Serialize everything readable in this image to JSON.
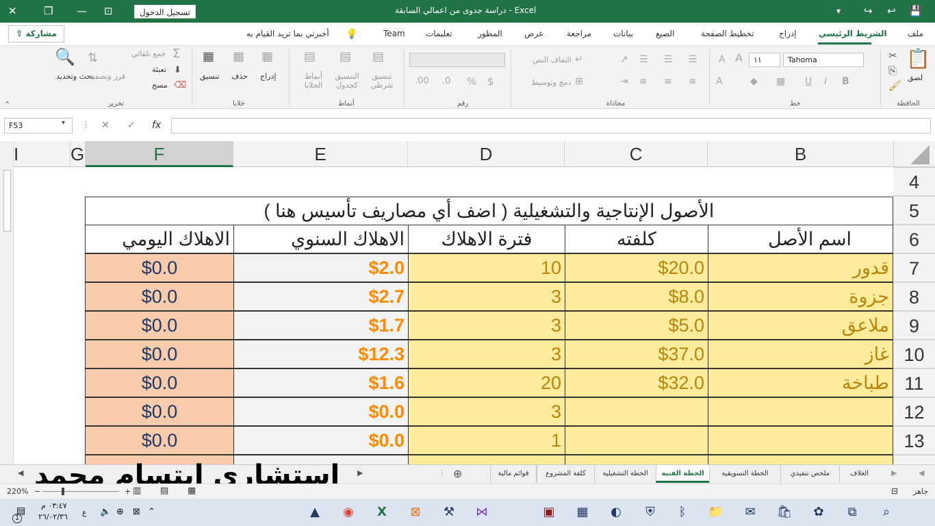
{
  "window": {
    "title": "دراسة جدوى من اعمالي السابقة  -  Excel",
    "signin": "تسجيل الدخول"
  },
  "ribbon_tabs": [
    "ملف",
    "الشريط الرئيسي",
    "إدراج",
    "تخطيط الصفحة",
    "الصيغ",
    "بيانات",
    "مراجعة",
    "عرض",
    "المطور",
    "تعليمات",
    "Team"
  ],
  "tell_me": "أخبرني بما تريد القيام به",
  "share": "مشاركة",
  "ribbon": {
    "clipboard": {
      "paste": "لصق",
      "group": "الحافظة"
    },
    "font": {
      "name": "Tahoma",
      "size": "١١",
      "group": "خط"
    },
    "alignment": {
      "wrap": "التفاف النص",
      "merge": "دمج وتوسيط",
      "group": "محاذاة"
    },
    "number": {
      "group": "رقم"
    },
    "styles": {
      "conditional": "تنسيق شرطي",
      "table": "التنسيق كجدول",
      "cell": "أنماط الخلايا",
      "group": "أنماط"
    },
    "cells": {
      "insert": "إدراج",
      "delete": "حذف",
      "format": "تنسيق",
      "group": "خلايا"
    },
    "editing": {
      "autosum": "جمع تلقائي",
      "fill": "تعبئة",
      "clear": "مسح",
      "sort": "فرز وتصفية",
      "find": "بحث وتحديد",
      "group": "تحرير"
    }
  },
  "formula_bar": {
    "name_box": "F53",
    "formula": ""
  },
  "columns": [
    "B",
    "C",
    "D",
    "E",
    "F",
    "G",
    "I"
  ],
  "rows": [
    "4",
    "5",
    "6",
    "7",
    "8",
    "9",
    "10",
    "11",
    "12",
    "13"
  ],
  "table": {
    "title": "الأصول الإنتاجية والتشغيلية ( اضف أي مصاريف تأسيس هنا )",
    "headers": [
      "اسم الأصل",
      "كلفته",
      "فترة الاهلاك",
      "الاهلاك السنوي",
      "الاهلاك اليومي"
    ],
    "data": [
      [
        "قدور",
        "$20.0",
        "10",
        "$2.0",
        "$0.0"
      ],
      [
        "جزوة",
        "$8.0",
        "3",
        "$2.7",
        "$0.0"
      ],
      [
        "ملاعق",
        "$5.0",
        "3",
        "$1.7",
        "$0.0"
      ],
      [
        "غاز",
        "$37.0",
        "3",
        "$12.3",
        "$0.0"
      ],
      [
        "طباخة",
        "$32.0",
        "20",
        "$1.6",
        "$0.0"
      ],
      [
        "",
        "",
        "3",
        "$0.0",
        "$0.0"
      ],
      [
        "",
        "",
        "1",
        "$0.0",
        "$0.0"
      ]
    ]
  },
  "sheets": [
    "الغلاف",
    "ملخص تنفيذي",
    "الخطة التسويقية",
    "الخطة الفنية",
    "الخطة التشغيلية",
    "كلفة المشروع",
    "قوائم مالية"
  ],
  "active_sheet": "الخطة الفنية",
  "watermark": "استشاري  ابتسام  محمد",
  "status": {
    "ready": "جاهز",
    "zoom": "220%"
  },
  "clock": {
    "time": "٠٣:٤٧ م",
    "date": "٢٦/٠٢/٣٦"
  },
  "taskbar_icons": [
    "search-icon",
    "taskview-icon",
    "copilot-icon",
    "store-icon",
    "mail-icon",
    "explorer-icon",
    "bluetooth-icon",
    "defender-icon",
    "edge-icon",
    "calculator-icon",
    "winrar-icon",
    "visual-studio-icon",
    "tools-icon",
    "xampp-icon",
    "excel-icon",
    "chrome-icon",
    "photos-icon"
  ],
  "colors": {
    "excel_green": "#217346",
    "orange": "#ff8c00",
    "yellow_fill": "#ffeb9c",
    "orange_fill": "#f8cbad",
    "gold_text": "#b8860b"
  }
}
